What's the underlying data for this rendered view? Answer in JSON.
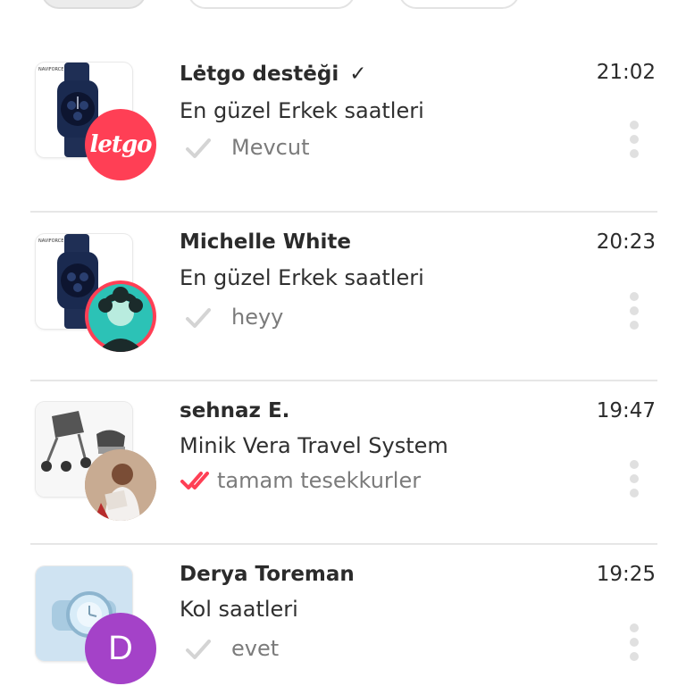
{
  "filters": [
    {
      "label": ""
    },
    {
      "label": ""
    },
    {
      "label": ""
    }
  ],
  "conversations": [
    {
      "name": "Lėtgo destėği",
      "verified": "✓",
      "subject": "En güzel Erkek saatleri",
      "preview": "Mevcut",
      "time": "21:02",
      "avatar_text": "letgo",
      "status": "sent"
    },
    {
      "name": "Michelle White",
      "subject": "En güzel Erkek saatleri",
      "preview": "heyy",
      "time": "20:23",
      "status": "sent"
    },
    {
      "name": "sehnaz E.",
      "subject": "Minik Vera Travel System",
      "preview": "tamam tesekkurler",
      "time": "19:47",
      "status": "read"
    },
    {
      "name": "Derya Toreman",
      "subject": "Kol saatleri",
      "preview": "evet",
      "time": "19:25",
      "avatar_text": "D",
      "status": "sent"
    }
  ],
  "colors": {
    "brand": "#ff3f55",
    "read_check": "#ff3f55",
    "sent_check": "#d4d4d4",
    "avatar_teal": "#2cc2b6",
    "avatar_purple": "#a442c8"
  },
  "icons": {
    "more": "vertical-dots-icon",
    "sent": "single-check-icon",
    "read": "double-check-icon"
  }
}
